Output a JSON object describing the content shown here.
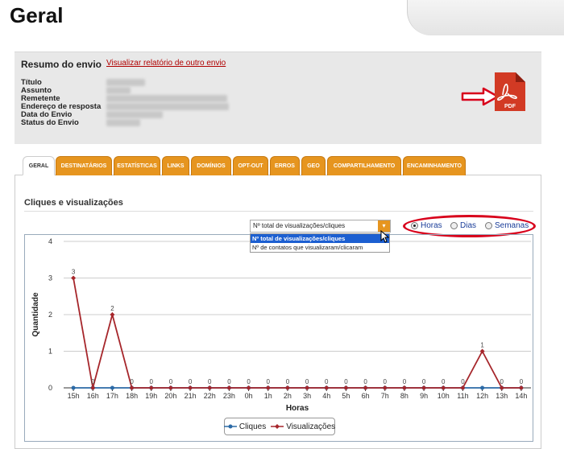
{
  "page": {
    "title": "Geral"
  },
  "summary": {
    "title": "Resumo do envio",
    "link": "Visualizar relatório de outro envio",
    "fields": [
      "Título",
      "Assunto",
      "Remetente",
      "Endereço de resposta",
      "Data do Envio",
      "Status do Envio"
    ],
    "pdf_label": "PDF"
  },
  "tabs": [
    "GERAL",
    "DESTINATÁRIOS",
    "ESTATÍSTICAS",
    "LINKS",
    "DOMÍNIOS",
    "OPT-OUT",
    "ERROS",
    "GEO",
    "COMPARTILHAMENTO",
    "ENCAMINHAMENTO"
  ],
  "section": {
    "title": "Cliques e visualizações"
  },
  "metric_select": {
    "value": "Nº total de visualizações/cliques",
    "options": [
      "Nº total de visualizações/cliques",
      "Nº de contatos que visualizaram/clicaram"
    ]
  },
  "granularity": {
    "options": [
      "Horas",
      "Dias",
      "Semanas"
    ],
    "selected": "Horas"
  },
  "colors": {
    "accent": "#e6951f",
    "cliques": "#2c6aa6",
    "visualizacoes": "#a6262b",
    "highlight": "#d8001b"
  },
  "chart_data": {
    "type": "line",
    "x": [
      "15h",
      "16h",
      "17h",
      "18h",
      "19h",
      "20h",
      "21h",
      "22h",
      "23h",
      "0h",
      "1h",
      "2h",
      "3h",
      "4h",
      "5h",
      "6h",
      "7h",
      "8h",
      "9h",
      "10h",
      "11h",
      "12h",
      "13h",
      "14h"
    ],
    "series": [
      {
        "name": "Cliques",
        "values": [
          0,
          0,
          0,
          0,
          0,
          0,
          0,
          0,
          0,
          0,
          0,
          0,
          0,
          0,
          0,
          0,
          0,
          0,
          0,
          0,
          0,
          0,
          0,
          0
        ]
      },
      {
        "name": "Visualizações",
        "values": [
          3,
          0,
          2,
          0,
          0,
          0,
          0,
          0,
          0,
          0,
          0,
          0,
          0,
          0,
          0,
          0,
          0,
          0,
          0,
          0,
          0,
          1,
          0,
          0
        ]
      }
    ],
    "xlabel": "Horas",
    "ylabel": "Quantidade",
    "yticks": [
      0,
      1,
      2,
      3,
      4
    ],
    "ylim": [
      0,
      4
    ],
    "grid": true,
    "legend": "bottom"
  }
}
